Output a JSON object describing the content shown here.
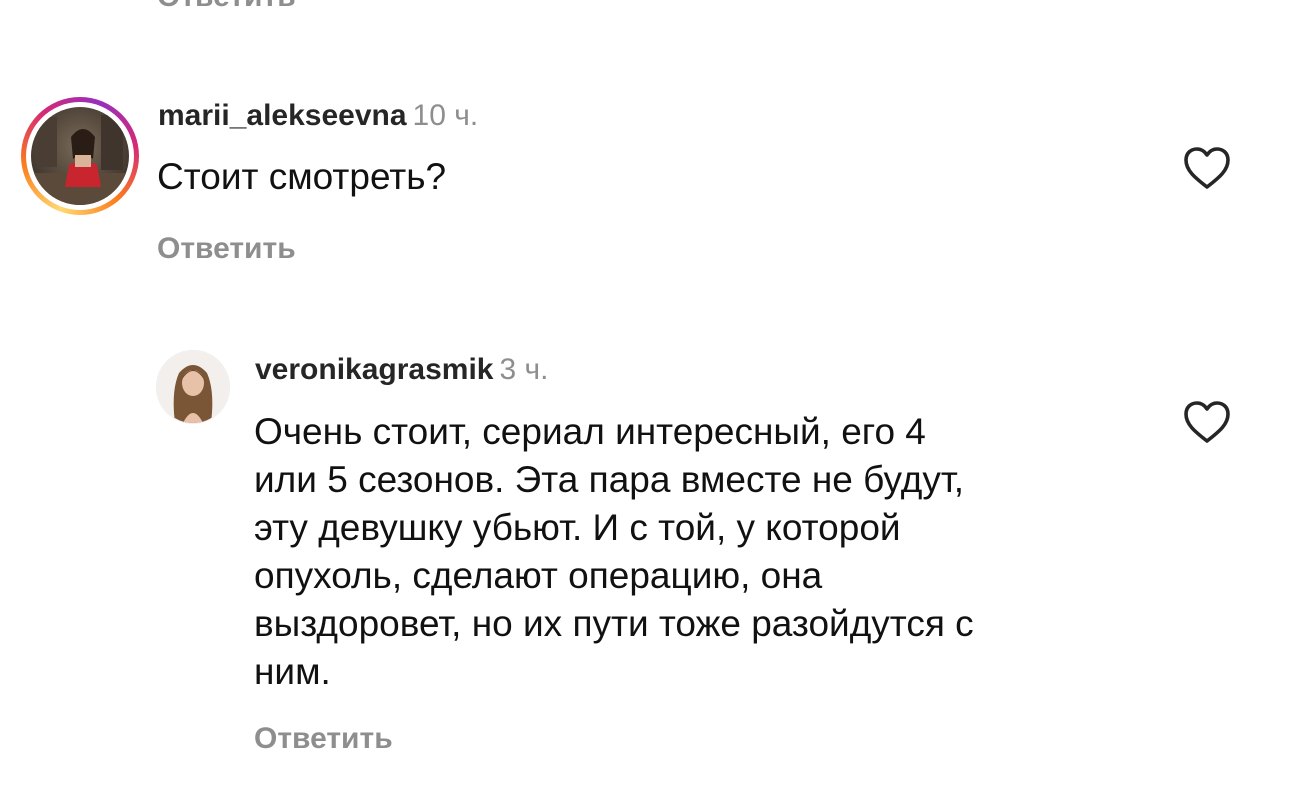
{
  "top_partial_reply_label": "Ответить",
  "comments": [
    {
      "username": "marii_alekseevna",
      "time": "10 ч.",
      "text": "Стоит смотреть?",
      "reply_label": "Ответить"
    },
    {
      "username": "veronikagrasmik",
      "time": "3 ч.",
      "text_lines": [
        "Очень стоит, сериал интересный, его 4",
        "или 5 сезонов. Эта пара вместе не будут,",
        "эту девушку убьют. И с той, у которой",
        "опухоль, сделают операцию, она",
        "выздоровет, но их пути тоже разойдутся с",
        "ним."
      ],
      "reply_label": "Ответить"
    }
  ],
  "icons": {
    "like": "heart-outline-icon"
  },
  "colors": {
    "secondary_text": "#8e8e8e",
    "primary_text": "#262626",
    "story_ring": [
      "#feda75",
      "#fa7e1e",
      "#d62976",
      "#962fbf"
    ]
  }
}
